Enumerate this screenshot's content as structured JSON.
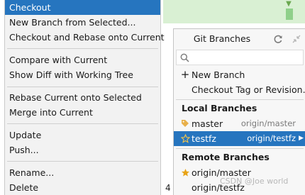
{
  "context_menu": {
    "items": [
      {
        "label": "Checkout",
        "selected": true
      },
      {
        "label": "New Branch from Selected..."
      },
      {
        "label": "Checkout and Rebase onto Current"
      },
      {
        "label": "Compare with Current"
      },
      {
        "label": "Show Diff with Working Tree"
      },
      {
        "label": "Rebase Current onto Selected"
      },
      {
        "label": "Merge into Current"
      },
      {
        "label": "Update"
      },
      {
        "label": "Push..."
      },
      {
        "label": "Rename..."
      },
      {
        "label": "Delete"
      }
    ]
  },
  "git_branches": {
    "title": "Git Branches",
    "search": {
      "value": "",
      "placeholder": ""
    },
    "actions": [
      {
        "label": "New Branch",
        "icon": "plus-icon"
      },
      {
        "label": "Checkout Tag or Revision..."
      }
    ],
    "local_header": "Local Branches",
    "local_branches": [
      {
        "name": "master",
        "tracking": "origin/master",
        "icon": "tag-icon"
      },
      {
        "name": "testfz",
        "tracking": "origin/testfz",
        "icon": "star-outline-icon",
        "selected": true
      }
    ],
    "remote_header": "Remote Branches",
    "remote_branches": [
      {
        "name": "origin/master",
        "icon": "star-filled-icon"
      },
      {
        "name": "origin/testfz"
      }
    ]
  },
  "background": {
    "line_number": "4"
  },
  "watermark": "CSDN @Joe world",
  "colors": {
    "selection": "#2675bf",
    "menu_bg": "#f2f2f2",
    "popup_bg": "#f7f7f7",
    "star": "#e8a317",
    "tag": "#e8b04a"
  }
}
